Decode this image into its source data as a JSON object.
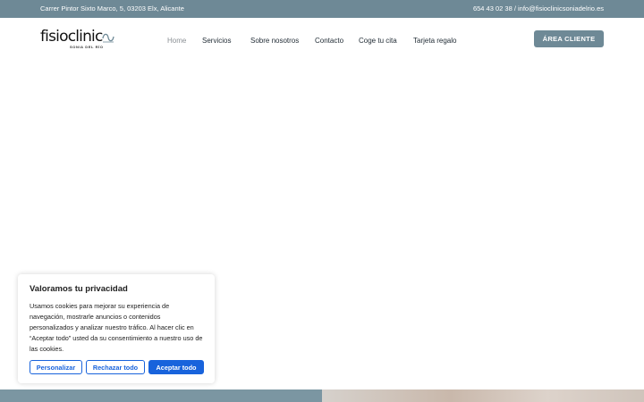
{
  "topbar": {
    "address": "Carrer Pintor Sixto Marco, 5, 03203 Elx, Alicante",
    "contact": "654 43 02 38 / info@fisioclinicsoniadelrio.es",
    "background": "#6e8996"
  },
  "logo": {
    "wordmark": "fisioclinic",
    "tagline": "SONIA DEL RÍO"
  },
  "nav": {
    "items": [
      {
        "label": "Home",
        "active": true
      },
      {
        "label": "Servicios"
      },
      {
        "label": "Sobre nosotros"
      },
      {
        "label": "Contacto"
      },
      {
        "label": "Coge tu cita"
      },
      {
        "label": "Tarjeta regalo"
      }
    ]
  },
  "header": {
    "cta_label": "ÁREA CLIENTE"
  },
  "cookie_banner": {
    "title": "Valoramos tu privacidad",
    "body": "Usamos cookies para mejorar su experiencia de navegación, mostrarle anuncios o contenidos personalizados y analizar nuestro tráfico. Al hacer clic en “Aceptar todo” usted da su consentimiento a nuestro uso de las cookies.",
    "customize_label": "Personalizar",
    "reject_label": "Rechazar todo",
    "accept_label": "Aceptar todo",
    "accent_color": "#1863dc"
  }
}
